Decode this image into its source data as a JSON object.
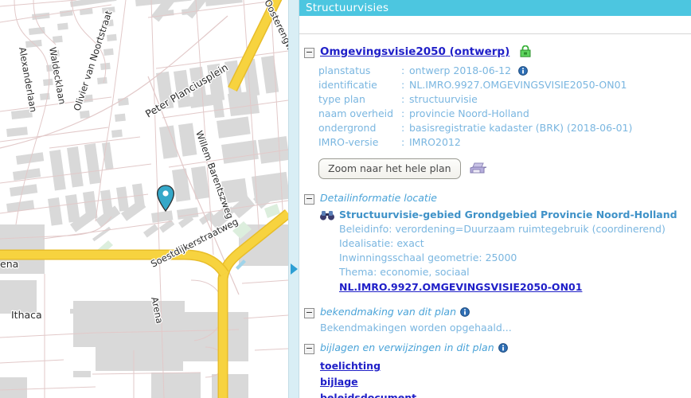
{
  "panel": {
    "header_title": "Structuurvisies",
    "plan": {
      "toggle_icon": "minus-box-icon",
      "title": "Omgevingsvisie2050 (ontwerp)",
      "lock_icon": "green-padlock-icon",
      "properties": [
        {
          "key": "planstatus",
          "value": "ontwerp 2018-06-12",
          "info_icon": "info-icon"
        },
        {
          "key": "identificatie",
          "value": "NL.IMRO.9927.OMGEVINGSVISIE2050-ON01"
        },
        {
          "key": "type plan",
          "value": "structuurvisie"
        },
        {
          "key": "naam overheid",
          "value": "provincie Noord-Holland"
        },
        {
          "key": "ondergrond",
          "value": "basisregistratie kadaster (BRK) (2018-06-01)"
        },
        {
          "key": "IMRO-versie",
          "value": "IMRO2012"
        }
      ],
      "zoom_button_label": "Zoom naar het hele plan",
      "print_icon": "printer-icon"
    },
    "detail_section": {
      "toggle_icon": "minus-box-icon",
      "heading": "Detailinformatie locatie",
      "binoculars_icon": "binoculars-icon",
      "title": "Structuurvisie-gebied Grondgebied Provincie Noord-Holland",
      "lines": [
        "Beleidinfo: verordening=Duurzaam ruimtegebruik (coordinerend)",
        "Idealisatie: exact",
        "Inwinningsschaal geometrie: 25000",
        "Thema: economie, sociaal"
      ],
      "link": "NL.IMRO.9927.OMGEVINGSVISIE2050-ON01"
    },
    "announcement_section": {
      "toggle_icon": "minus-box-icon",
      "heading": "bekendmaking van dit plan",
      "info_icon": "info-icon",
      "status_text": "Bekendmakingen worden opgehaald..."
    },
    "attachments_section": {
      "toggle_icon": "minus-box-icon",
      "heading": "bijlagen en verwijzingen in dit plan",
      "info_icon": "info-icon",
      "links": [
        "toelichting",
        "bijlage",
        "beleidsdocument"
      ]
    },
    "colors": {
      "header_bg": "#4cc6e0",
      "label_blue": "#7ab6e0",
      "heading_blue": "#4aa3d8",
      "link_blue": "#2020c8"
    }
  },
  "splitter": {
    "collapse_icon": "triangle-right-icon",
    "color": "#2e9fd4"
  },
  "map": {
    "marker_icon": "location-pin-icon",
    "marker_color": "#35a8c9",
    "street_labels": [
      "Alexanderlaan",
      "Waldecklaan",
      "Olivier van Noortstraat",
      "Peter Planciusplein",
      "Willem Barentszweg",
      "Oosterengweg",
      "Soestdijkerstraatweg",
      "Arena",
      "Ithaca",
      "ena"
    ],
    "highway_color": "#f7d33f"
  }
}
